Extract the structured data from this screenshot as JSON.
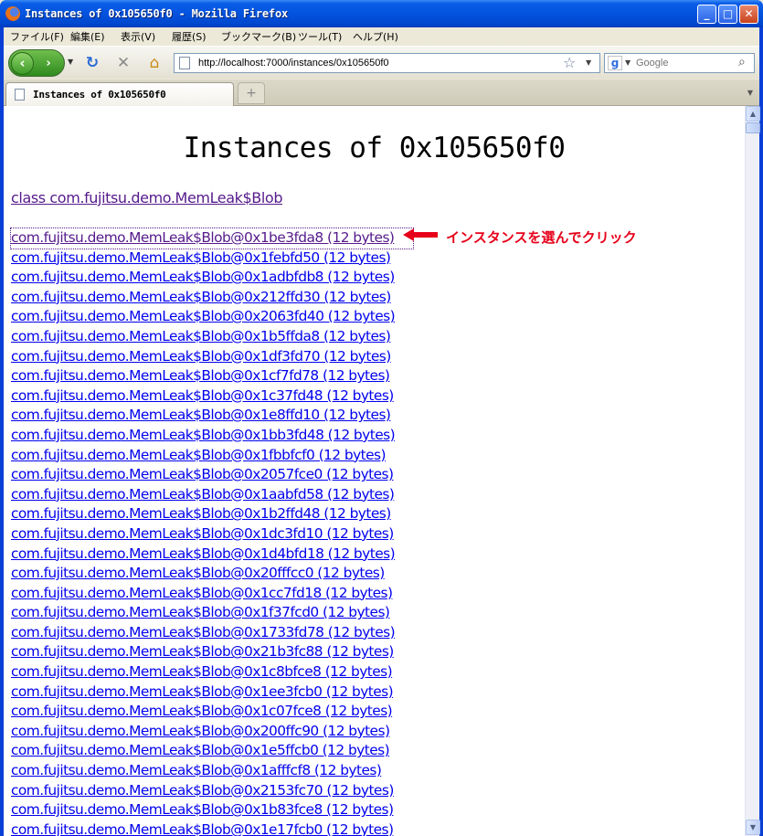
{
  "window": {
    "title": "Instances of 0x105650f0 - Mozilla Firefox"
  },
  "menu": [
    "ファイル(F)",
    "編集(E)",
    "表示(V)",
    "履歴(S)",
    "ブックマーク(B)",
    "ツール(T)",
    "ヘルプ(H)"
  ],
  "nav": {
    "url": "http://localhost:7000/instances/0x105650f0",
    "search_placeholder": "Google"
  },
  "tabs": {
    "active_label": "Instances of 0x105650f0",
    "new_tab_symbol": "+"
  },
  "page": {
    "title": "Instances of 0x105650f0",
    "class_link": "class com.fujitsu.demo.MemLeak$Blob",
    "annotation": "インスタンスを選んでクリック",
    "instances": [
      "com.fujitsu.demo.MemLeak$Blob@0x1be3fda8 (12 bytes)",
      "com.fujitsu.demo.MemLeak$Blob@0x1febfd50 (12 bytes)",
      "com.fujitsu.demo.MemLeak$Blob@0x1adbfdb8 (12 bytes)",
      "com.fujitsu.demo.MemLeak$Blob@0x212ffd30 (12 bytes)",
      "com.fujitsu.demo.MemLeak$Blob@0x2063fd40 (12 bytes)",
      "com.fujitsu.demo.MemLeak$Blob@0x1b5ffda8 (12 bytes)",
      "com.fujitsu.demo.MemLeak$Blob@0x1df3fd70 (12 bytes)",
      "com.fujitsu.demo.MemLeak$Blob@0x1cf7fd78 (12 bytes)",
      "com.fujitsu.demo.MemLeak$Blob@0x1c37fd48 (12 bytes)",
      "com.fujitsu.demo.MemLeak$Blob@0x1e8ffd10 (12 bytes)",
      "com.fujitsu.demo.MemLeak$Blob@0x1bb3fd48 (12 bytes)",
      "com.fujitsu.demo.MemLeak$Blob@0x1fbbfcf0 (12 bytes)",
      "com.fujitsu.demo.MemLeak$Blob@0x2057fce0 (12 bytes)",
      "com.fujitsu.demo.MemLeak$Blob@0x1aabfd58 (12 bytes)",
      "com.fujitsu.demo.MemLeak$Blob@0x1b2ffd48 (12 bytes)",
      "com.fujitsu.demo.MemLeak$Blob@0x1dc3fd10 (12 bytes)",
      "com.fujitsu.demo.MemLeak$Blob@0x1d4bfd18 (12 bytes)",
      "com.fujitsu.demo.MemLeak$Blob@0x20fffcc0 (12 bytes)",
      "com.fujitsu.demo.MemLeak$Blob@0x1cc7fd18 (12 bytes)",
      "com.fujitsu.demo.MemLeak$Blob@0x1f37fcd0 (12 bytes)",
      "com.fujitsu.demo.MemLeak$Blob@0x1733fd78 (12 bytes)",
      "com.fujitsu.demo.MemLeak$Blob@0x21b3fc88 (12 bytes)",
      "com.fujitsu.demo.MemLeak$Blob@0x1c8bfce8 (12 bytes)",
      "com.fujitsu.demo.MemLeak$Blob@0x1ee3fcb0 (12 bytes)",
      "com.fujitsu.demo.MemLeak$Blob@0x1c07fce8 (12 bytes)",
      "com.fujitsu.demo.MemLeak$Blob@0x200ffc90 (12 bytes)",
      "com.fujitsu.demo.MemLeak$Blob@0x1e5ffcb0 (12 bytes)",
      "com.fujitsu.demo.MemLeak$Blob@0x1afffcf8 (12 bytes)",
      "com.fujitsu.demo.MemLeak$Blob@0x2153fc70 (12 bytes)",
      "com.fujitsu.demo.MemLeak$Blob@0x1b83fce8 (12 bytes)",
      "com.fujitsu.demo.MemLeak$Blob@0x1e17fcb0 (12 bytes)"
    ]
  },
  "colors": {
    "link": "#0000ee",
    "visited_link": "#551a8b",
    "annotation": "#e6001a",
    "titlebar": "#0454e0"
  }
}
